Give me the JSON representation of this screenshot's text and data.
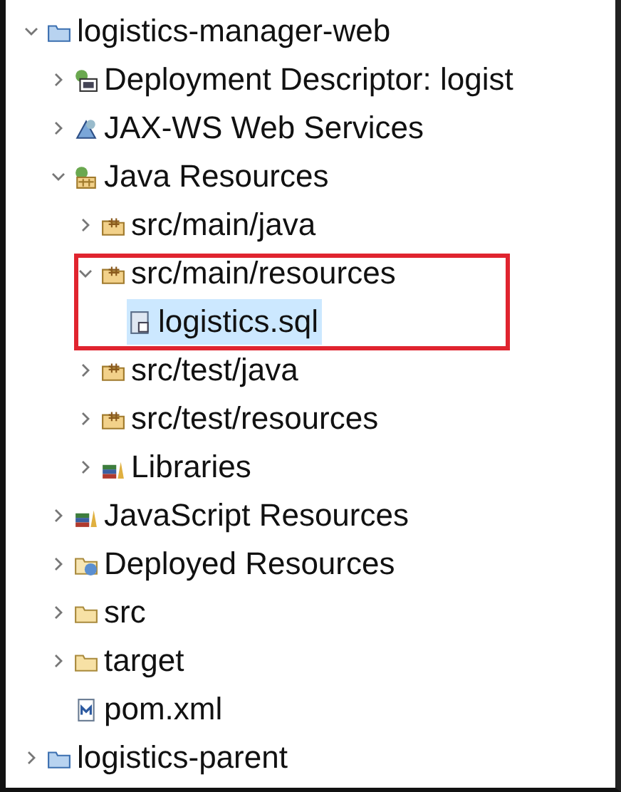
{
  "tree": [
    {
      "label": "logistics-manager-web",
      "kind": "project",
      "expanded": true,
      "selected": false,
      "children": [
        {
          "label": "Deployment Descriptor: logist",
          "kind": "descriptor",
          "expanded": false,
          "selected": false
        },
        {
          "label": "JAX-WS Web Services",
          "kind": "webservice",
          "expanded": false,
          "selected": false
        },
        {
          "label": "Java Resources",
          "kind": "java-resources",
          "expanded": true,
          "selected": false,
          "children": [
            {
              "label": "src/main/java",
              "kind": "package-folder",
              "expanded": false,
              "selected": false
            },
            {
              "label": "src/main/resources",
              "kind": "package-folder",
              "expanded": true,
              "selected": false,
              "boxed": true,
              "children": [
                {
                  "label": "logistics.sql",
                  "kind": "sql-file",
                  "selected": true
                }
              ]
            },
            {
              "label": "src/test/java",
              "kind": "package-folder",
              "expanded": false,
              "selected": false
            },
            {
              "label": "src/test/resources",
              "kind": "package-folder",
              "expanded": false,
              "selected": false
            },
            {
              "label": "Libraries",
              "kind": "library",
              "expanded": false,
              "selected": false
            }
          ]
        },
        {
          "label": "JavaScript Resources",
          "kind": "library",
          "expanded": false,
          "selected": false
        },
        {
          "label": "Deployed Resources",
          "kind": "deployed",
          "expanded": false,
          "selected": false
        },
        {
          "label": "src",
          "kind": "folder",
          "expanded": false,
          "selected": false
        },
        {
          "label": "target",
          "kind": "folder",
          "expanded": false,
          "selected": false
        },
        {
          "label": "pom.xml",
          "kind": "xml-file",
          "selected": false
        }
      ]
    },
    {
      "label": "logistics-parent",
      "kind": "project",
      "expanded": false,
      "selected": false
    }
  ]
}
